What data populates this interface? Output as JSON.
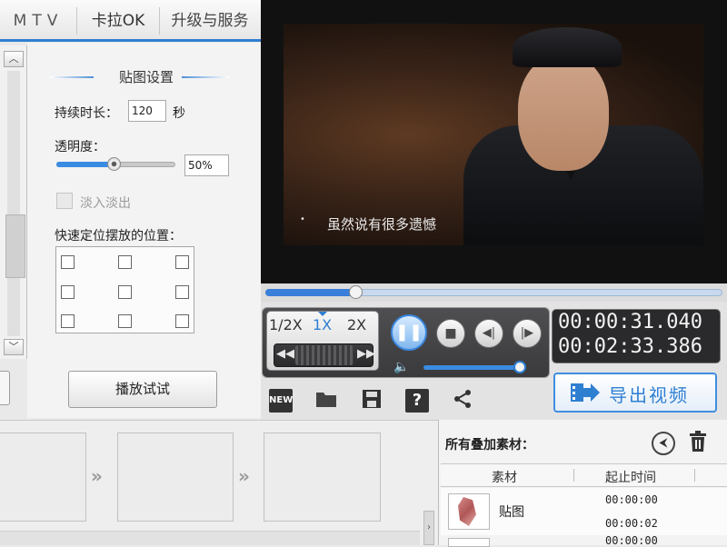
{
  "tabs": {
    "mtv": "MTV",
    "karaoke": "卡拉OK",
    "upgrade": "升级与服务"
  },
  "settings": {
    "title": "贴图设置",
    "duration_label": "持续时长：",
    "duration_value": "120",
    "duration_unit": "秒",
    "opacity_label": "透明度：",
    "opacity_value": "50%",
    "opacity_level": 0.5,
    "fade_label": "淡入淡出",
    "fade_checked": false,
    "position_label": "快速定位摆放的位置：",
    "position_grid_cells": 9,
    "play_try_label": "播放试试"
  },
  "video": {
    "subtitle": "虽然说有很多遗憾",
    "progress_fraction": 0.198
  },
  "player": {
    "speeds": [
      "1/2X",
      "1X",
      "2X"
    ],
    "active_speed": "1X",
    "time_current": "00:00:31.040",
    "time_total": "00:02:33.386",
    "volume_level": 0.92
  },
  "toolbar": {
    "new_label": "NEW",
    "export_label": "导出视频",
    "icons": [
      "new-file-icon",
      "open-folder-icon",
      "save-icon",
      "help-icon",
      "share-icon"
    ]
  },
  "overlay": {
    "title": "所有叠加素材：",
    "col_material": "素材",
    "col_start_time": "起止时间",
    "rows": [
      {
        "name": "贴图",
        "start": "00:00:00",
        "end": "00:00:02"
      },
      {
        "name": "",
        "start": "00:00:00",
        "end": ""
      }
    ]
  },
  "colors": {
    "accent": "#2f7fd1",
    "panel": "#f3f3f4",
    "video_bg": "#111111"
  }
}
